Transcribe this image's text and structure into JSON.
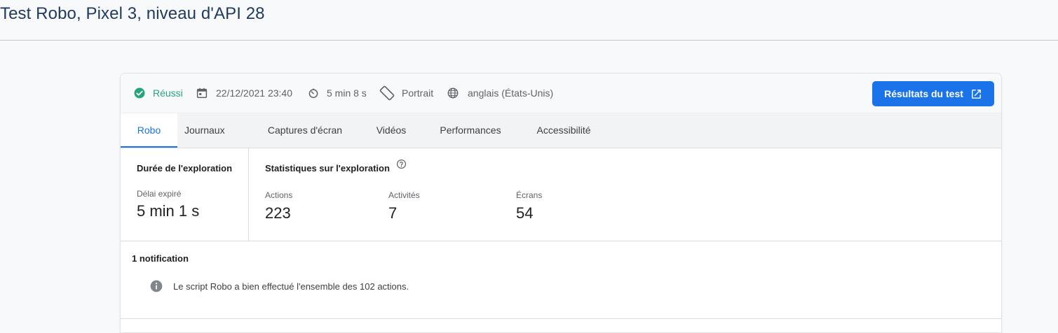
{
  "page": {
    "title": "Test Robo, Pixel 3, niveau d'API 28"
  },
  "meta": {
    "status": "Réussi",
    "status_icon": "check-circle-icon",
    "date": "22/12/2021 23:40",
    "date_icon": "calendar-icon",
    "duration": "5 min 8 s",
    "duration_icon": "timer-icon",
    "orientation": "Portrait",
    "orientation_icon": "screen-rotation-icon",
    "locale": "anglais (États-Unis)",
    "locale_icon": "globe-icon",
    "results_button": "Résultats du test",
    "results_button_icon": "open-in-new-icon"
  },
  "tabs": [
    {
      "label": "Robo",
      "active": true
    },
    {
      "label": "Journaux",
      "active": false
    },
    {
      "label": "Captures d'écran",
      "active": false
    },
    {
      "label": "Vidéos",
      "active": false
    },
    {
      "label": "Performances",
      "active": false
    },
    {
      "label": "Accessibilité",
      "active": false
    }
  ],
  "duration_panel": {
    "title": "Durée de l'exploration",
    "label": "Délai expiré",
    "value": "5 min 1 s"
  },
  "stats_panel": {
    "title": "Statistiques sur l'exploration",
    "help_icon": "help-outline-icon",
    "stats": [
      {
        "label": "Actions",
        "value": "223"
      },
      {
        "label": "Activités",
        "value": "7"
      },
      {
        "label": "Écrans",
        "value": "54"
      }
    ]
  },
  "notifications": {
    "title": "1 notification",
    "items": [
      {
        "icon": "info-icon",
        "text": "Le script Robo a bien effectué l'ensemble des 102 actions."
      }
    ]
  },
  "colors": {
    "accent": "#1a73e8",
    "success": "#1e8e3e",
    "title": "#1f3a5f"
  }
}
